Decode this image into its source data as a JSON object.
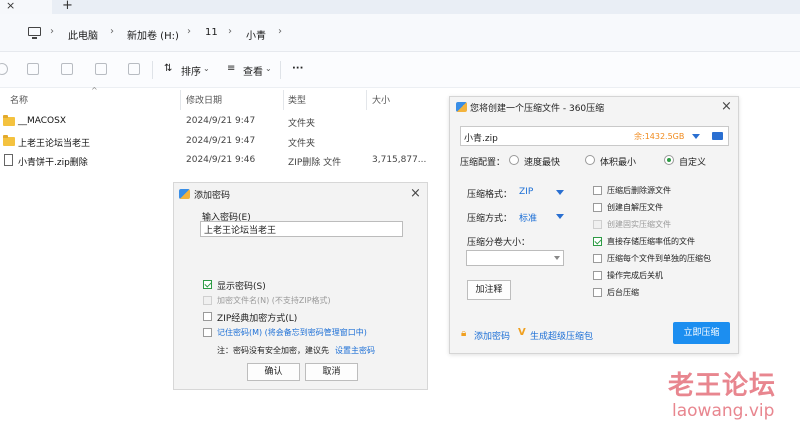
{
  "breadcrumb": [
    "此电脑",
    "新加卷 (H:)",
    "11",
    "小青"
  ],
  "toolbar": {
    "sort_label": "排序",
    "view_label": "查看",
    "more_label": "···"
  },
  "columns": {
    "name": "名称",
    "modified": "修改日期",
    "type": "类型",
    "size": "大小"
  },
  "files": [
    {
      "name": "__MACOSX",
      "modified": "2024/9/21 9:47",
      "type": "文件夹",
      "size": "",
      "icon": "folder-icon"
    },
    {
      "name": "上老王论坛当老王",
      "modified": "2024/9/21 9:47",
      "type": "文件夹",
      "size": "",
      "icon": "folder-icon"
    },
    {
      "name": "小青饼干.zip删除",
      "modified": "2024/9/21 9:46",
      "type": "ZIP删除 文件",
      "size": "3,715,877...",
      "icon": "file-icon"
    }
  ],
  "password_dialog": {
    "title": "添加密码",
    "input_label": "输入密码(E)",
    "password_value": "上老王论坛当老王",
    "show_password": "显示密码(S)",
    "encrypt_filenames": "加密文件名(N) (不支持ZIP格式)",
    "zip_classic": "ZIP经典加密方式(L)",
    "remember_password": "记住密码(M) (将会备忘到密码管理窗口中)",
    "note": "注：密码没有安全加密，建议先",
    "note_link": "设置主密码",
    "ok": "确认",
    "cancel": "取消"
  },
  "zip_dialog": {
    "title": "您将创建一个压缩文件 - 360压缩",
    "filename": "小青.zip",
    "free_space": "余:1432.5GB",
    "config_label": "压缩配置：",
    "config_options": [
      "速度最快",
      "体积最小",
      "自定义"
    ],
    "config_selected": "自定义",
    "format_label": "压缩格式：",
    "format_value": "ZIP",
    "method_label": "压缩方式：",
    "method_value": "标准",
    "split_label": "压缩分卷大小：",
    "split_value": "",
    "add_comment": "加注释",
    "options": [
      {
        "label": "压缩后删除源文件",
        "checked": false,
        "disabled": false
      },
      {
        "label": "创建自解压文件",
        "checked": false,
        "disabled": false
      },
      {
        "label": "创建固实压缩文件",
        "checked": false,
        "disabled": true
      },
      {
        "label": "直接存储压缩率低的文件",
        "checked": true,
        "disabled": false
      },
      {
        "label": "压缩每个文件到单独的压缩包",
        "checked": false,
        "disabled": false
      },
      {
        "label": "操作完成后关机",
        "checked": false,
        "disabled": false
      },
      {
        "label": "后台压缩",
        "checked": false,
        "disabled": false
      }
    ],
    "add_password": "添加密码",
    "make_sfx": "生成超级压缩包",
    "compress_now": "立即压缩"
  },
  "watermark": {
    "cn": "老王论坛",
    "en": "laowang.vip"
  },
  "colors": {
    "accent": "#1c8ef0",
    "check": "#2e9b45",
    "link": "#1c6fd6",
    "watermark": "#e8868f",
    "folder": "#f4c23f"
  }
}
